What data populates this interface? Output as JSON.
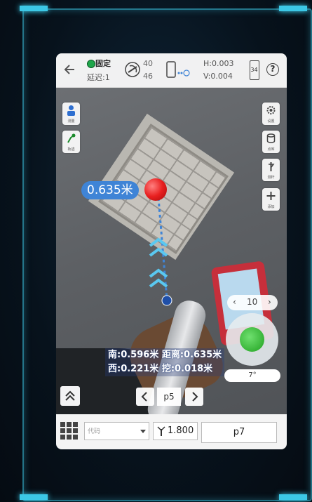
{
  "status": {
    "fix_label": "固定",
    "delay_label": "延迟:1",
    "sat_used": "40",
    "sat_total": "46",
    "h_precision": "H:0.003",
    "v_precision": "V:0.004",
    "battery": "34",
    "help": "?"
  },
  "left_tools": [
    {
      "label": "测量"
    },
    {
      "label": "轨迹"
    }
  ],
  "right_tools": [
    {
      "label": "设置"
    },
    {
      "label": "点库"
    },
    {
      "label": "测杆"
    },
    {
      "label": "添加"
    }
  ],
  "overlay": {
    "distance_badge": "0.635米",
    "south": "南:0.596米",
    "distance": "距离:0.635米",
    "west": "西:0.221米",
    "dig": "挖:0.018米",
    "step_value": "10",
    "tilt_angle": "7°",
    "point_name": "p5"
  },
  "toolbar": {
    "code_placeholder": "代码",
    "pole_height": "1.800",
    "point_name": "p7"
  },
  "colors": {
    "accent_blue": "#3f84d6",
    "target_red": "#e82020",
    "fix_green": "#1ea64a",
    "frame_cyan": "#3cc8e6"
  }
}
